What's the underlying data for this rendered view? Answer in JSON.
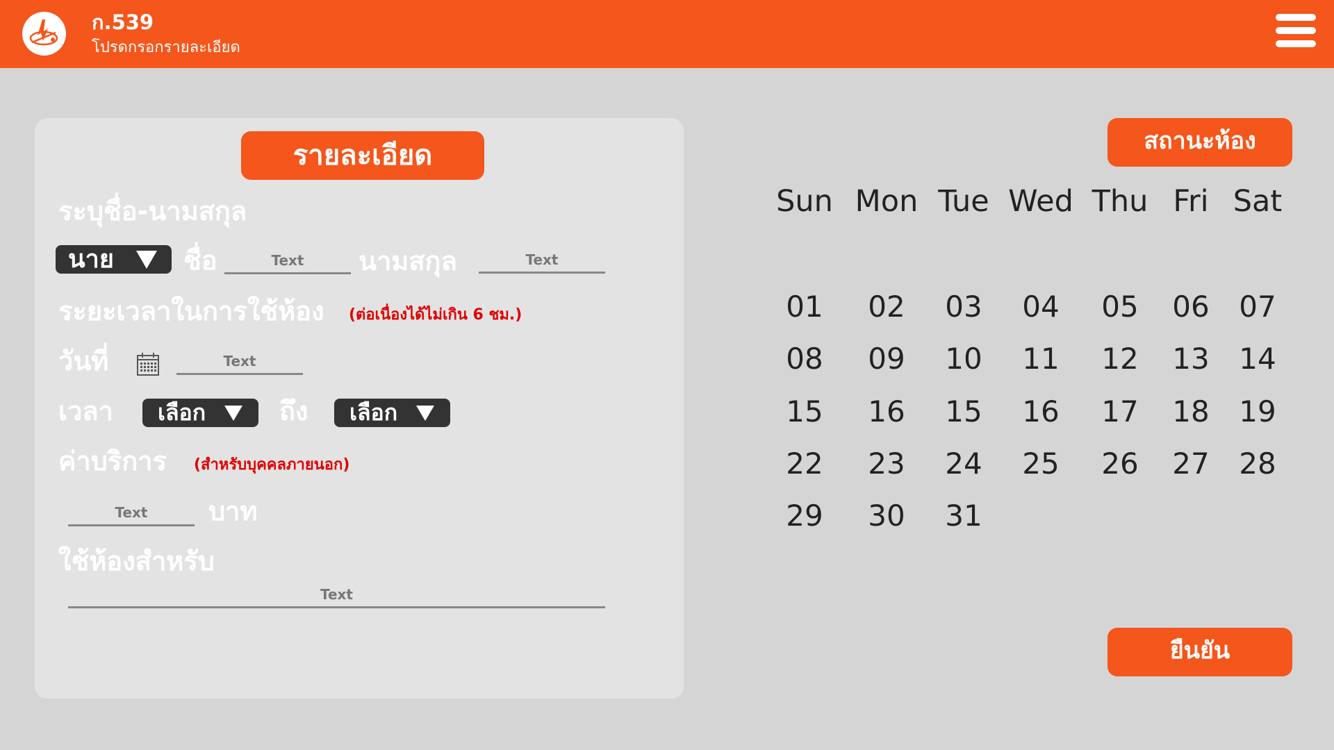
{
  "header": {
    "code": "ก.539",
    "subtitle": "โปรดกรอกรายละเอียด",
    "logo_icon": "logo-icon",
    "menu_icon": "hamburger-menu-icon"
  },
  "form": {
    "title": "รายละเอียด",
    "name_section": "ระบุชื่อ-นามสกุล",
    "prefix_value": "นาย",
    "first_name_label": "ชื่อ",
    "first_name_placeholder": "Text",
    "last_name_label": "นามสกุล",
    "last_name_placeholder": "Text",
    "duration_section": "ระยะเวลาในการใช้ห้อง",
    "duration_note": "(ต่อเนื่องได้ไม่เกิน 6 ชม.)",
    "date_label": "วันที่",
    "date_placeholder": "Text",
    "time_label": "เวลา",
    "time_from_value": "เลือก",
    "time_to_label": "ถึง",
    "time_to_value": "เลือก",
    "fee_section": "ค่าบริการ",
    "fee_note": "(สำหรับบุคคลภายนอก)",
    "fee_placeholder": "Text",
    "fee_unit": "บาท",
    "purpose_section": "ใช้ห้องสำหรับ",
    "purpose_placeholder": "Text"
  },
  "calendar": {
    "status_button": "สถานะห้อง",
    "days_of_week": [
      "Sun",
      "Mon",
      "Tue",
      "Wed",
      "Thu",
      "Fri",
      "Sat"
    ],
    "weeks": [
      [
        "01",
        "02",
        "03",
        "04",
        "05",
        "06",
        "07"
      ],
      [
        "08",
        "09",
        "10",
        "11",
        "12",
        "13",
        "14"
      ],
      [
        "15",
        "16",
        "15",
        "16",
        "17",
        "18",
        "19"
      ],
      [
        "22",
        "23",
        "24",
        "25",
        "26",
        "27",
        "28"
      ],
      [
        "29",
        "30",
        "31"
      ]
    ]
  },
  "confirm_button": "ยืนยัน",
  "colors": {
    "accent": "#f4561b",
    "background": "#d5d5d5",
    "panel": "#e3e3e3",
    "dropdown": "#333333",
    "note": "#e10000"
  }
}
